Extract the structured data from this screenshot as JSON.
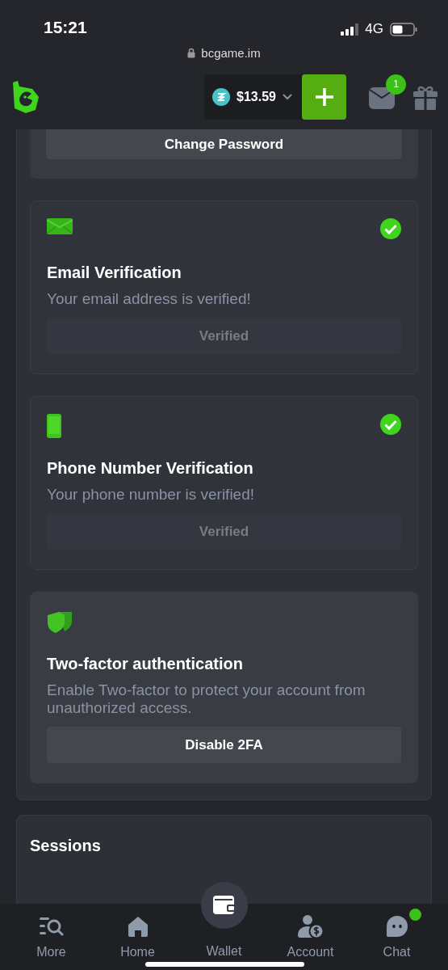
{
  "status_bar": {
    "time": "15:21",
    "network": "4G"
  },
  "browser": {
    "url": "bcgame.im"
  },
  "header": {
    "balance": "$13.59",
    "mail_badge": "1"
  },
  "cut_card": {
    "button": "Change Password"
  },
  "cards": [
    {
      "title": "Email Verification",
      "text": "Your email address is verified!",
      "button": "Verified",
      "verified": true
    },
    {
      "title": "Phone Number Verification",
      "text": "Your phone number is verified!",
      "button": "Verified",
      "verified": true
    },
    {
      "title": "Two-factor authentication",
      "text": "Enable Two-factor to protect your account from unauthorized access.",
      "button": "Disable 2FA",
      "verified": false
    }
  ],
  "sessions": {
    "title": "Sessions"
  },
  "bottom_nav": [
    {
      "label": "More",
      "selected": false,
      "unread": false
    },
    {
      "label": "Home",
      "selected": false,
      "unread": false
    },
    {
      "label": "Wallet",
      "selected": false,
      "unread": false
    },
    {
      "label": "Account",
      "selected": false,
      "unread": false
    },
    {
      "label": "Chat",
      "selected": false,
      "unread": true
    }
  ]
}
